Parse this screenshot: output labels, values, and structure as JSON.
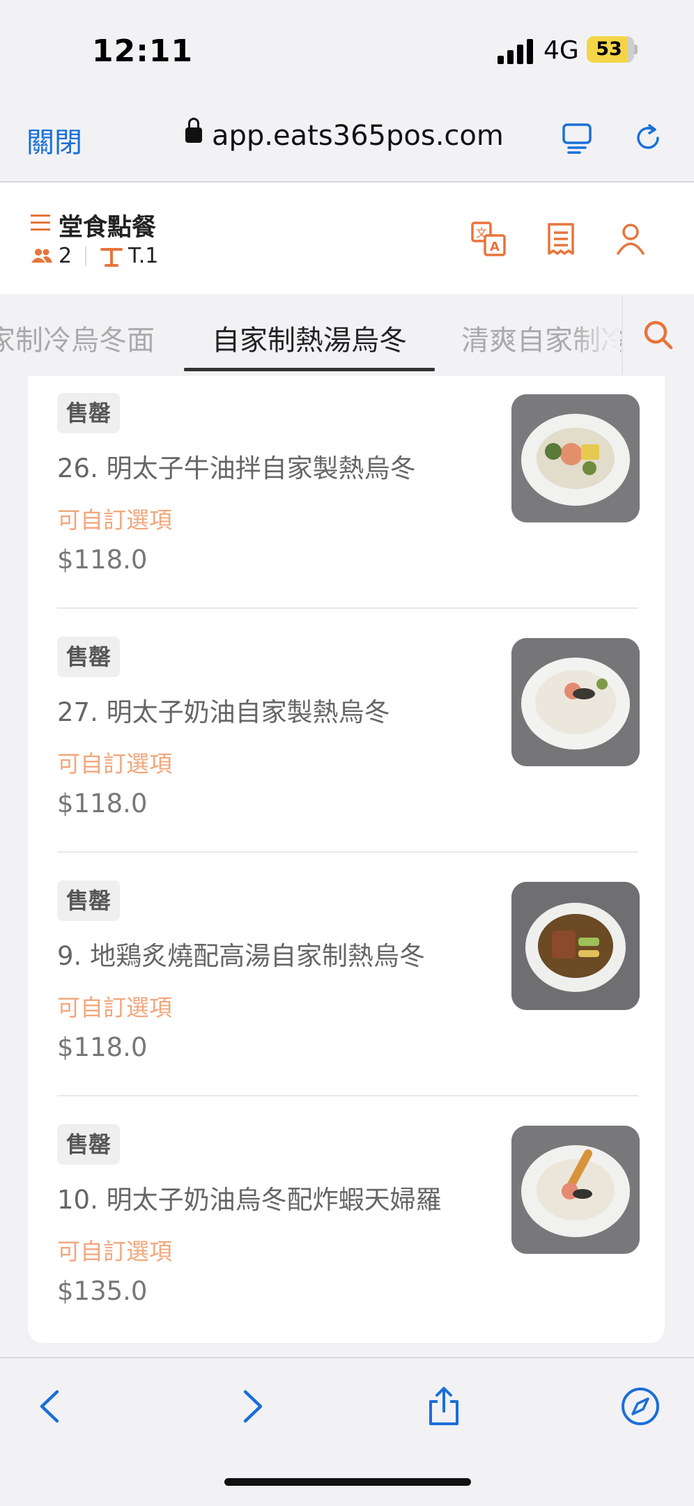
{
  "status_bar": {
    "time": "12:11",
    "network": "4G",
    "battery": "53"
  },
  "browser": {
    "close_label": "關閉",
    "url": "app.eats365pos.com",
    "icons": [
      "reader-icon",
      "reload-icon",
      "back-icon",
      "forward-icon",
      "share-icon",
      "compass-icon"
    ]
  },
  "header": {
    "title": "堂食點餐",
    "guest_count": "2",
    "table": "T.1",
    "icons": [
      "translate-icon",
      "receipt-icon",
      "user-icon"
    ]
  },
  "tabs": [
    {
      "label": "家制冷烏冬面",
      "active": false
    },
    {
      "label": "自家制熱湯烏冬",
      "active": true
    },
    {
      "label": "清爽自家制冷",
      "active": false
    }
  ],
  "items": [
    {
      "badge": "售罄",
      "name": "26. 明太子牛油拌自家製熱烏冬",
      "custom": "可自訂選項",
      "price": "$118.0"
    },
    {
      "badge": "售罄",
      "name": "27. 明太子奶油自家製熱烏冬",
      "custom": "可自訂選項",
      "price": "$118.0"
    },
    {
      "badge": "售罄",
      "name": "9. 地鶏炙燒配高湯自家制熱烏冬",
      "custom": "可自訂選項",
      "price": "$118.0"
    },
    {
      "badge": "售罄",
      "name": "10. 明太子奶油烏冬配炸蝦天婦羅",
      "custom": "可自訂選項",
      "price": "$135.0"
    }
  ],
  "colors": {
    "accent": "#e8743b",
    "link": "#1a6fd8",
    "custom_text": "#f2a77d",
    "battery": "#f5d547"
  }
}
